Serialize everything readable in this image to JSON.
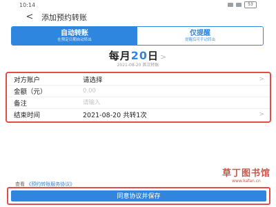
{
  "status_bar": {
    "time": "10:14",
    "battery": "53"
  },
  "header": {
    "title": "添加预约转账",
    "back_icon": "back-arrow-icon"
  },
  "tabs": [
    {
      "title": "自动转账",
      "subtitle": "在预定日期自动转出",
      "active": true
    },
    {
      "title": "仅提醒",
      "subtitle": "提醒后可手动转出",
      "active": false
    }
  ],
  "frequency": {
    "prefix": "每月",
    "day": "20",
    "suffix": "日",
    "caption": "2021-08-20 首次转账"
  },
  "form": {
    "rows": [
      {
        "label": "对方账户",
        "value": "请选择",
        "chevron": true
      },
      {
        "label": "金额（元）",
        "placeholder": "0.00"
      },
      {
        "label": "备注",
        "placeholder": "请输入"
      },
      {
        "label": "结束时间",
        "value": "2021-08-20 共转1次",
        "chevron": true
      }
    ]
  },
  "agreement": {
    "prefix": "查看",
    "link": "《预约转账服务协议》"
  },
  "submit": {
    "label": "同意协议并保存"
  },
  "watermark": {
    "text": "草丁图书馆",
    "sub": "www.kafan.cn"
  },
  "colors": {
    "accent": "#2f86df",
    "highlight": "#e24b4b"
  }
}
